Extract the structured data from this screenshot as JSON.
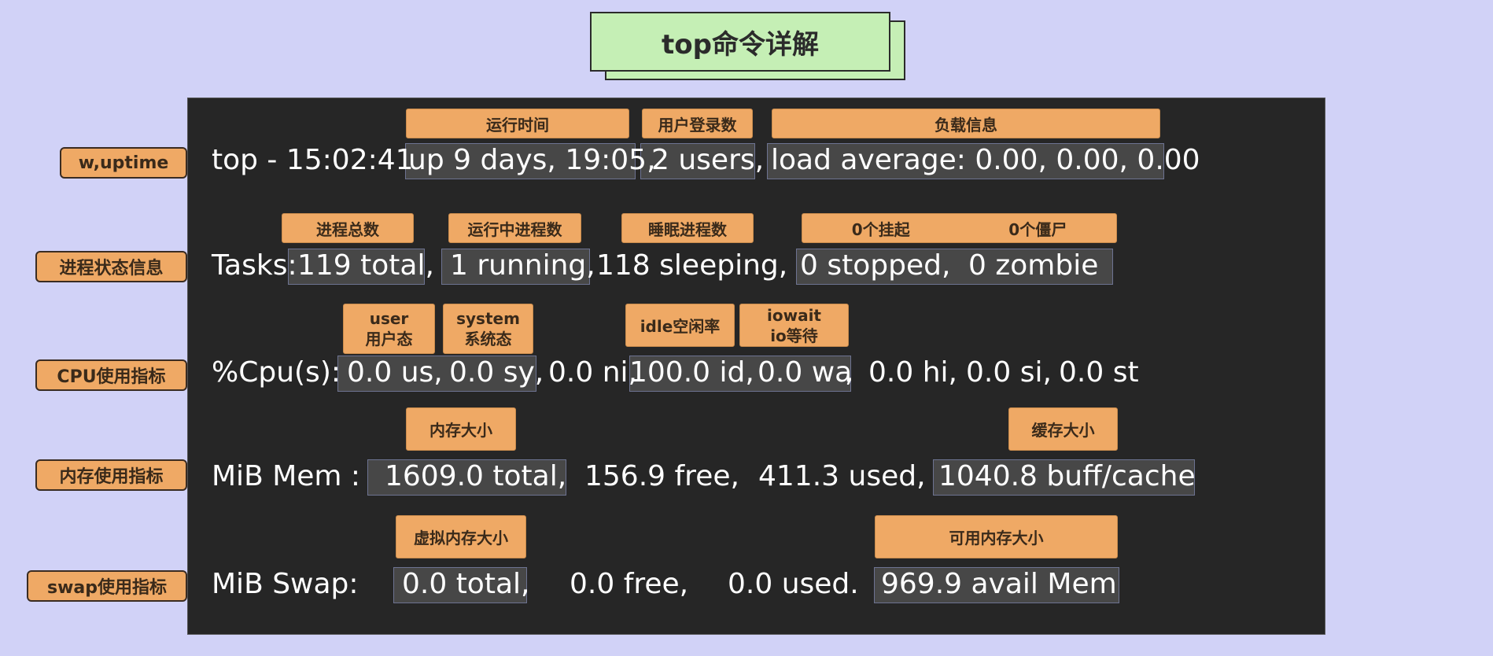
{
  "title": "top命令详解",
  "sections": {
    "uptime": "w,uptime",
    "tasks": "进程状态信息",
    "cpu": "CPU使用指标",
    "mem": "内存使用指标",
    "swap": "swap使用指标"
  },
  "tags": {
    "run_time": "运行时间",
    "users_login": "用户登录数",
    "load_info": "负载信息",
    "total_procs": "进程总数",
    "running_procs": "运行中进程数",
    "sleeping_procs": "睡眠进程数",
    "stopped": "0个挂起",
    "zombie": "0个僵尸",
    "user_l1": "user",
    "user_l2": "用户态",
    "system_l1": "system",
    "system_l2": "系统态",
    "idle": "idle空闲率",
    "iowait_l1": "iowait",
    "iowait_l2": "io等待",
    "mem_size": "内存大小",
    "cache_size": "缓存大小",
    "swap_size": "虚拟内存大小",
    "avail_size": "可用内存大小"
  },
  "lines": {
    "l1": [
      "top - 15:02:41",
      "up 9 days, 19:05,",
      "2 users,",
      "load average: 0.00, 0.00, 0.00"
    ],
    "l2": [
      "Tasks:",
      "119 total,",
      "1 running,",
      "118 sleeping,",
      "0 stopped,",
      "0 zombie"
    ],
    "l3": [
      "%Cpu(s):",
      "0.0 us,",
      "0.0 sy,",
      "0.0 ni,",
      "100.0 id,",
      "0.0 wa",
      ",",
      "0.0 hi,",
      "0.0 si,",
      "0.0 st"
    ],
    "l4": [
      "MiB Mem :",
      "1609.0 total,",
      "156.9 free,",
      "411.3 used,",
      "1040.8 buff/cache"
    ],
    "l5": [
      "MiB Swap:",
      "0.0 total,",
      "0.0 free,",
      "0.0 used.",
      "969.9 avail Mem"
    ]
  },
  "colors": {
    "background": "#d1d2f7",
    "title_box": "#c5efb5",
    "panel": "#262626",
    "tag": "#efa965",
    "highlight": "#474747"
  }
}
